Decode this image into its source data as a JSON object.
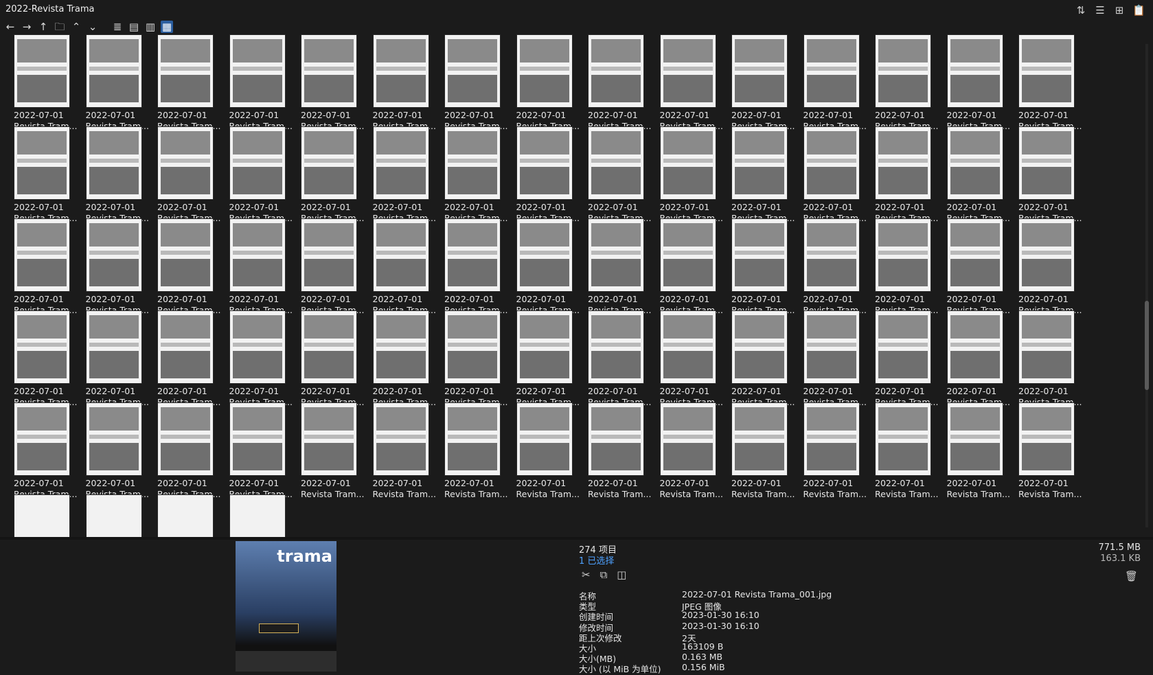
{
  "window": {
    "title": "2022-Revista Trama"
  },
  "toolbar": {
    "icons": [
      "arrow-left-icon",
      "arrow-right-icon",
      "arrow-up-icon",
      "folder-icon",
      "chevron-up-icon",
      "chevron-down-icon",
      "list-view-icon",
      "details-view-icon",
      "tiles-view-icon",
      "thumbnails-view-icon"
    ],
    "right_icons": [
      "sort-icon",
      "columns-icon",
      "add-icon",
      "clipboard-icon"
    ]
  },
  "grid": {
    "items": [
      {
        "date": "2022-07-01",
        "name": "Revista Tram..."
      },
      {
        "date": "2022-07-01",
        "name": "Revista Tram..."
      },
      {
        "date": "2022-07-01",
        "name": "Revista Tram..."
      },
      {
        "date": "2022-07-01",
        "name": "Revista Tram..."
      },
      {
        "date": "2022-07-01",
        "name": "Revista Tram..."
      },
      {
        "date": "2022-07-01",
        "name": "Revista Tram..."
      },
      {
        "date": "2022-07-01",
        "name": "Revista Tram..."
      },
      {
        "date": "2022-07-01",
        "name": "Revista Tram..."
      },
      {
        "date": "2022-07-01",
        "name": "Revista Tram..."
      },
      {
        "date": "2022-07-01",
        "name": "Revista Tram..."
      },
      {
        "date": "2022-07-01",
        "name": "Revista Tram..."
      },
      {
        "date": "2022-07-01",
        "name": "Revista Tram..."
      },
      {
        "date": "2022-07-01",
        "name": "Revista Tram..."
      },
      {
        "date": "2022-07-01",
        "name": "Revista Tram..."
      },
      {
        "date": "2022-07-01",
        "name": "Revista Tram..."
      },
      {
        "date": "2022-07-01",
        "name": "Revista Tram..."
      },
      {
        "date": "2022-07-01",
        "name": "Revista Tram..."
      },
      {
        "date": "2022-07-01",
        "name": "Revista Tram..."
      },
      {
        "date": "2022-07-01",
        "name": "Revista Tram..."
      },
      {
        "date": "2022-07-01",
        "name": "Revista Tram..."
      },
      {
        "date": "2022-07-01",
        "name": "Revista Tram..."
      },
      {
        "date": "2022-07-01",
        "name": "Revista Tram..."
      },
      {
        "date": "2022-07-01",
        "name": "Revista Tram..."
      },
      {
        "date": "2022-07-01",
        "name": "Revista Tram..."
      },
      {
        "date": "2022-07-01",
        "name": "Revista Tram..."
      },
      {
        "date": "2022-07-01",
        "name": "Revista Tram..."
      },
      {
        "date": "2022-07-01",
        "name": "Revista Tram..."
      },
      {
        "date": "2022-07-01",
        "name": "Revista Tram..."
      },
      {
        "date": "2022-07-01",
        "name": "Revista Tram..."
      },
      {
        "date": "2022-07-01",
        "name": "Revista Tram..."
      },
      {
        "date": "2022-07-01",
        "name": "Revista Tram..."
      },
      {
        "date": "2022-07-01",
        "name": "Revista Tram..."
      },
      {
        "date": "2022-07-01",
        "name": "Revista Tram..."
      },
      {
        "date": "2022-07-01",
        "name": "Revista Tram..."
      },
      {
        "date": "2022-07-01",
        "name": "Revista Tram..."
      },
      {
        "date": "2022-07-01",
        "name": "Revista Tram..."
      },
      {
        "date": "2022-07-01",
        "name": "Revista Tram..."
      },
      {
        "date": "2022-07-01",
        "name": "Revista Tram..."
      },
      {
        "date": "2022-07-01",
        "name": "Revista Tram..."
      },
      {
        "date": "2022-07-01",
        "name": "Revista Tram..."
      },
      {
        "date": "2022-07-01",
        "name": "Revista Tram..."
      },
      {
        "date": "2022-07-01",
        "name": "Revista Tram..."
      },
      {
        "date": "2022-07-01",
        "name": "Revista Tram..."
      },
      {
        "date": "2022-07-01",
        "name": "Revista Tram..."
      },
      {
        "date": "2022-07-01",
        "name": "Revista Tram..."
      },
      {
        "date": "2022-07-01",
        "name": "Revista Tram..."
      },
      {
        "date": "2022-07-01",
        "name": "Revista Tram..."
      },
      {
        "date": "2022-07-01",
        "name": "Revista Tram..."
      },
      {
        "date": "2022-07-01",
        "name": "Revista Tram..."
      },
      {
        "date": "2022-07-01",
        "name": "Revista Tram..."
      },
      {
        "date": "2022-07-01",
        "name": "Revista Tram..."
      },
      {
        "date": "2022-07-01",
        "name": "Revista Tram..."
      },
      {
        "date": "2022-07-01",
        "name": "Revista Tram..."
      },
      {
        "date": "2022-07-01",
        "name": "Revista Tram..."
      },
      {
        "date": "2022-07-01",
        "name": "Revista Tram..."
      },
      {
        "date": "2022-07-01",
        "name": "Revista Tram..."
      },
      {
        "date": "2022-07-01",
        "name": "Revista Tram..."
      },
      {
        "date": "2022-07-01",
        "name": "Revista Tram..."
      },
      {
        "date": "2022-07-01",
        "name": "Revista Tram..."
      },
      {
        "date": "2022-07-01",
        "name": "Revista Tram..."
      },
      {
        "date": "2022-07-01",
        "name": "Revista Tram..."
      },
      {
        "date": "2022-07-01",
        "name": "Revista Tram..."
      },
      {
        "date": "2022-07-01",
        "name": "Revista Tram..."
      },
      {
        "date": "2022-07-01",
        "name": "Revista Tram..."
      },
      {
        "date": "2022-07-01",
        "name": "Revista Tram..."
      },
      {
        "date": "2022-07-01",
        "name": "Revista Tram..."
      },
      {
        "date": "2022-07-01",
        "name": "Revista Tram..."
      },
      {
        "date": "2022-07-01",
        "name": "Revista Tram..."
      },
      {
        "date": "2022-07-01",
        "name": "Revista Tram..."
      },
      {
        "date": "2022-07-01",
        "name": "Revista Tram..."
      },
      {
        "date": "2022-07-01",
        "name": "Revista Tram..."
      },
      {
        "date": "2022-07-01",
        "name": "Revista Tram..."
      },
      {
        "date": "2022-07-01",
        "name": "Revista Tram..."
      },
      {
        "date": "2022-07-01",
        "name": "Revista Tram..."
      },
      {
        "date": "2022-07-01",
        "name": "Revista Tram..."
      }
    ]
  },
  "preview": {
    "logo_text": "trama",
    "count": "274 项目",
    "selected": "1 已选择",
    "size_total": "771.5 MB",
    "size_selected": "163.1 KB",
    "action_icons": [
      "cut-icon",
      "copy-icon",
      "compare-icon"
    ],
    "properties": [
      {
        "key": "名称",
        "value": "2022-07-01 Revista Trama_001.jpg"
      },
      {
        "key": "类型",
        "value": "JPEG 图像"
      },
      {
        "key": "创建时间",
        "value": "2023-01-30  16:10"
      },
      {
        "key": "修改时间",
        "value": "2023-01-30  16:10"
      },
      {
        "key": "距上次修改",
        "value": "2天"
      },
      {
        "key": "大小",
        "value": "163109 B"
      },
      {
        "key": "大小(MB)",
        "value": "0.163 MB"
      },
      {
        "key": "大小 (以 MiB 为单位)",
        "value": "0.156 MiB"
      }
    ]
  },
  "colors": {
    "background": "#1b1b1b",
    "accent": "#4ea1ff",
    "active_view": "#2b5e9f",
    "text": "#e6e6e6"
  }
}
